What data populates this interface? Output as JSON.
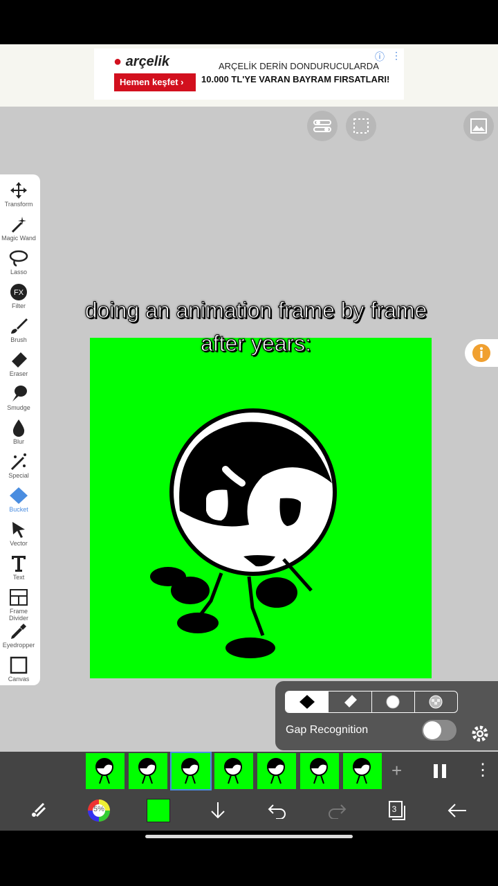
{
  "ad": {
    "brand": "arçelik",
    "cta": "Hemen keşfet",
    "line1": "ARÇELİK DERİN DONDURUCULARDA",
    "line2": "10.000 TL'YE VARAN BAYRAM FIRSATLARI!"
  },
  "caption": {
    "line1": "doing an animation frame by frame",
    "line2": "after years:"
  },
  "tools": [
    {
      "label": "Transform",
      "icon": "move-icon"
    },
    {
      "label": "Magic Wand",
      "icon": "magic-wand-icon"
    },
    {
      "label": "Lasso",
      "icon": "lasso-icon"
    },
    {
      "label": "Filter",
      "icon": "fx-icon"
    },
    {
      "label": "Brush",
      "icon": "brush-icon"
    },
    {
      "label": "Eraser",
      "icon": "eraser-icon"
    },
    {
      "label": "Smudge",
      "icon": "smudge-icon"
    },
    {
      "label": "Blur",
      "icon": "blur-drop-icon"
    },
    {
      "label": "Special",
      "icon": "special-wand-icon"
    },
    {
      "label": "Bucket",
      "icon": "bucket-icon"
    },
    {
      "label": "Vector",
      "icon": "vector-arrow-icon"
    },
    {
      "label": "Text",
      "icon": "text-icon"
    },
    {
      "label": "Frame Divider",
      "icon": "frame-divider-icon"
    },
    {
      "label": "Eyedropper",
      "icon": "eyedropper-icon"
    },
    {
      "label": "Canvas",
      "icon": "canvas-icon"
    }
  ],
  "bucket_panel": {
    "gap_label": "Gap Recognition",
    "gap_enabled": false
  },
  "colors": {
    "canvas_bg": "#00ff00",
    "accent": "#4a8de0",
    "brush_color": "#00ff00"
  },
  "status": {
    "brush_opacity": "5%",
    "layer_count": "3"
  },
  "frames": {
    "count": 7,
    "current_index": 2
  }
}
